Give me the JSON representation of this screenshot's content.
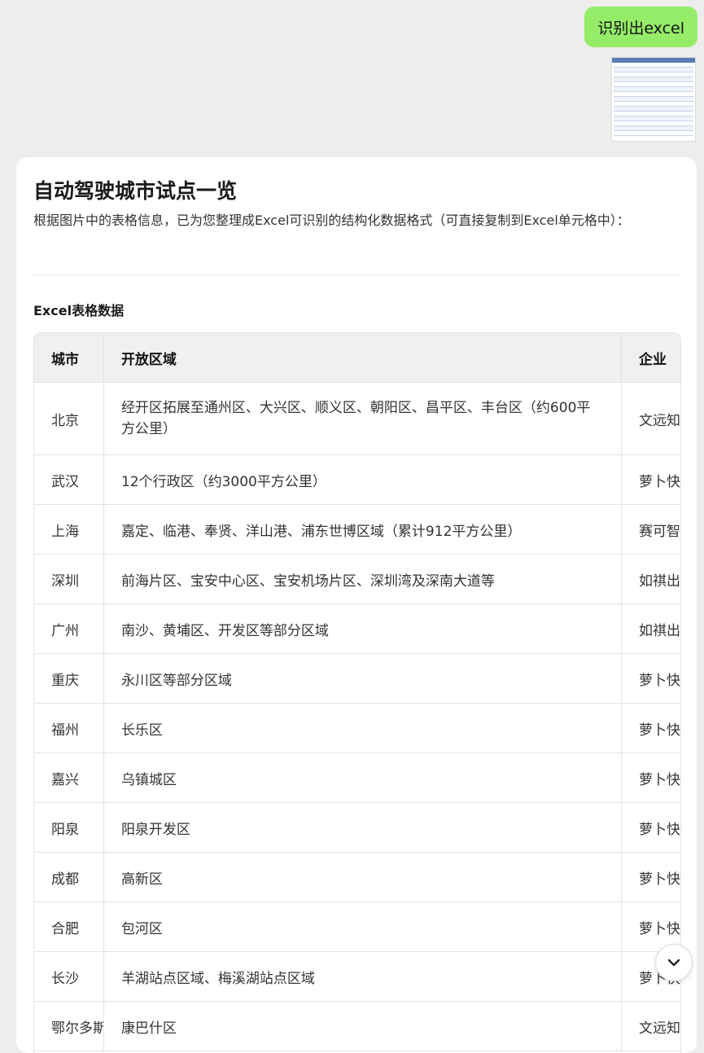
{
  "chat": {
    "user_message": "识别出excel"
  },
  "reply": {
    "title": "自动驾驶城市试点一览",
    "description": "根据图片中的表格信息，已为您整理成Excel可识别的结构化数据格式（可直接复制到Excel单元格中）：",
    "section_title": "Excel表格数据"
  },
  "table": {
    "headers": [
      "城市",
      "开放区域",
      "企业"
    ],
    "rows": [
      [
        "北京",
        "经开区拓展至通州区、大兴区、顺义区、朝阳区、昌平区、丰台区（约600平方公里）",
        "文远知行、"
      ],
      [
        "武汉",
        "12个行政区（约3000平方公里）",
        "萝卜快跑等"
      ],
      [
        "上海",
        "嘉定、临港、奉贤、洋山港、浦东世博区域（累计912平方公里）",
        "赛可智能、"
      ],
      [
        "深圳",
        "前海片区、宝安中心区、宝安机场片区、深圳湾及深南大道等",
        "如祺出行、"
      ],
      [
        "广州",
        "南沙、黄埔区、开发区等部分区域",
        "如祺出行、"
      ],
      [
        "重庆",
        "永川区等部分区域",
        "萝卜快跑等"
      ],
      [
        "福州",
        "长乐区",
        "萝卜快跑等"
      ],
      [
        "嘉兴",
        "乌镇城区",
        "萝卜快跑等"
      ],
      [
        "阳泉",
        "阳泉开发区",
        "萝卜快跑等"
      ],
      [
        "成都",
        "高新区",
        "萝卜快跑等"
      ],
      [
        "合肥",
        "包河区",
        "萝卜快跑等"
      ],
      [
        "长沙",
        "羊湖站点区域、梅溪湖站点区域",
        "萝卜快跑等"
      ],
      [
        "鄂尔多斯",
        "康巴什区",
        "文远知行等"
      ]
    ]
  },
  "icons": {
    "scroll_down": "chevron-down-icon"
  }
}
